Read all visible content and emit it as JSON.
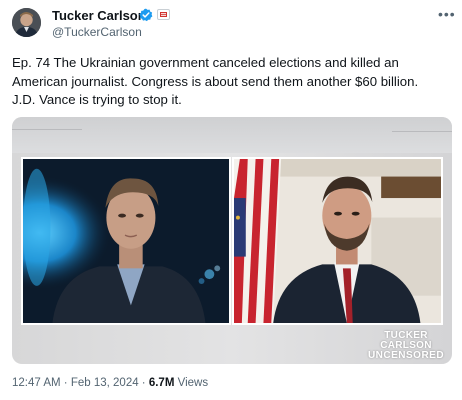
{
  "author": {
    "name": "Tucker Carlson",
    "handle": "@TuckerCarlson"
  },
  "icons": {
    "verified": "verified-badge-icon",
    "affiliate": "affiliate-badge-icon",
    "more": "more-options-icon",
    "avatar": "avatar"
  },
  "colors": {
    "verified_blue": "#1d9bf0",
    "text_primary": "#0f1419",
    "text_secondary": "#536471"
  },
  "tweet": {
    "text": "Ep. 74  The Ukrainian government canceled elections and killed an\nAmerican journalist. Congress is about send them another $60 billion.\nJ.D. Vance is trying to stop it."
  },
  "media": {
    "logo_line1": "TUCKER",
    "logo_line2": "CARLSON",
    "logo_line3": "UNCENSORED"
  },
  "meta": {
    "time": "12:47 AM",
    "sep1": " · ",
    "date": "Feb 13, 2024",
    "sep2": " · ",
    "views_count": "6.7M",
    "views_label": " Views"
  }
}
